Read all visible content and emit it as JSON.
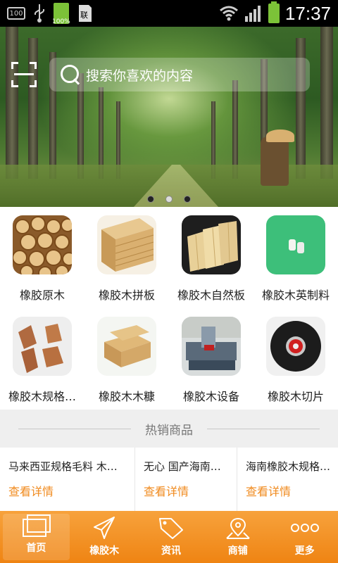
{
  "statusbar": {
    "time": "17:37",
    "left_box": "100",
    "battery_small_label": "100%",
    "icons": [
      "storage-icon",
      "usb-icon",
      "battery-charging-icon",
      "sim-icon",
      "wifi-icon",
      "signal-icon",
      "battery-icon"
    ]
  },
  "search": {
    "placeholder": "搜索你喜欢的内容"
  },
  "banner": {
    "slides": 3,
    "active_slide": 2
  },
  "categories": [
    {
      "label": "橡胶原木"
    },
    {
      "label": "橡胶木拼板"
    },
    {
      "label": "橡胶木自然板"
    },
    {
      "label": "橡胶木英制料"
    },
    {
      "label": "橡胶木规格…"
    },
    {
      "label": "橡胶木木糠"
    },
    {
      "label": "橡胶木设备"
    },
    {
      "label": "橡胶木切片"
    }
  ],
  "section": {
    "title": "热销商品"
  },
  "hot_items": [
    {
      "name": "马来西亚规格毛料 木…",
      "link": "查看详情"
    },
    {
      "name": "无心 国产海南…",
      "link": "查看详情"
    },
    {
      "name": "海南橡胶木规格…",
      "link": "查看详情"
    }
  ],
  "tabs": [
    {
      "label": "首页",
      "icon": "home-icon",
      "active": true
    },
    {
      "label": "橡胶木",
      "icon": "paper-plane-icon"
    },
    {
      "label": "资讯",
      "icon": "sale-tag-icon"
    },
    {
      "label": "商铺",
      "icon": "map-pin-icon"
    },
    {
      "label": "更多",
      "icon": "more-dots-icon"
    }
  ],
  "colors": {
    "accent": "#ef8413",
    "link": "#f08a1d"
  }
}
